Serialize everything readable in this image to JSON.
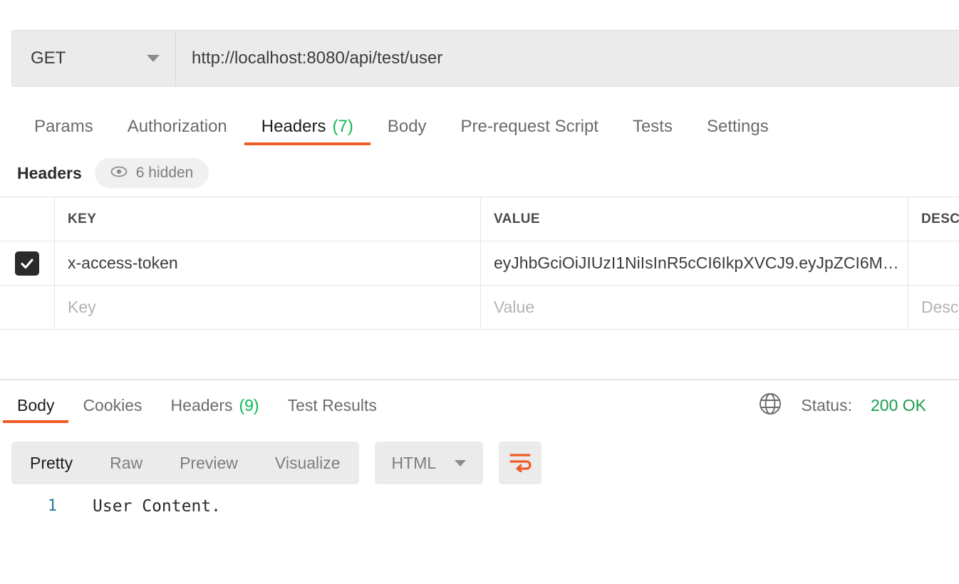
{
  "request": {
    "method": "GET",
    "url": "http://localhost:8080/api/test/user",
    "tabs": [
      {
        "label": "Params",
        "count": ""
      },
      {
        "label": "Authorization",
        "count": ""
      },
      {
        "label": "Headers",
        "count": "(7)"
      },
      {
        "label": "Body",
        "count": ""
      },
      {
        "label": "Pre-request Script",
        "count": ""
      },
      {
        "label": "Tests",
        "count": ""
      },
      {
        "label": "Settings",
        "count": ""
      }
    ],
    "headers_section": {
      "title": "Headers",
      "hidden_label": "6 hidden",
      "eye_icon": "eye-icon",
      "columns": [
        "KEY",
        "VALUE",
        "DESCRIPTION"
      ],
      "rows": [
        {
          "checked": true,
          "key": "x-access-token",
          "value": "eyJhbGciOiJIUzI1NiIsInR5cCI6IkpXVCJ9.eyJpZCI6M…",
          "description": ""
        }
      ],
      "placeholder_row": {
        "key": "Key",
        "value": "Value",
        "description": "Description"
      }
    }
  },
  "response": {
    "tabs": [
      {
        "label": "Body",
        "count": ""
      },
      {
        "label": "Cookies",
        "count": ""
      },
      {
        "label": "Headers",
        "count": "(9)"
      },
      {
        "label": "Test Results",
        "count": ""
      }
    ],
    "status_label": "Status:",
    "status_value": "200 OK",
    "globe_icon": "globe-icon",
    "view_modes": [
      "Pretty",
      "Raw",
      "Preview",
      "Visualize"
    ],
    "format": "HTML",
    "wrap_icon": "wrap-lines-icon",
    "body_lines": [
      {
        "number": "1",
        "text": "User Content."
      }
    ]
  },
  "colors": {
    "accent_orange": "#ef5b25",
    "count_green": "#0cbb52",
    "status_green": "#1a9c4e",
    "line_number_blue": "#2b7a9b",
    "field_gray": "#ebebeb"
  }
}
